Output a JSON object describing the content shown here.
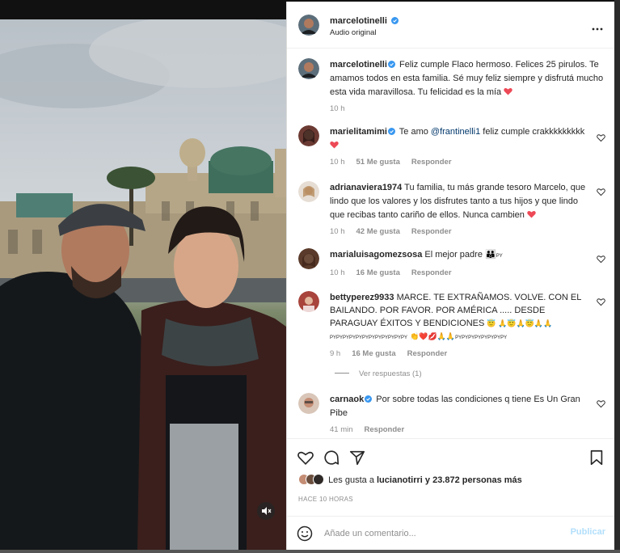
{
  "post": {
    "author": "marcelotinelli",
    "audio": "Audio original",
    "caption_user": "marcelotinelli",
    "caption_text": "Feliz cumple Flaco hermoso. Felices 25 pirulos. Te amamos todos en esta familia. Sé muy feliz siempre y disfrutá mucho esta vida maravillosa. Tu felicidad es la mía",
    "caption_time": "10 h"
  },
  "comments": [
    {
      "user": "marielitamimi",
      "pre": "Te amo ",
      "mention": "@frantinelli1",
      "text": " feliz cumple crakkkkkkkkk",
      "time": "10 h",
      "likes": "51 Me gusta",
      "reply": "Responder"
    },
    {
      "user": "adrianaviera1974",
      "text": "Tu familia, tu más grande tesoro Marcelo, que lindo que los valores y los disfrutes tanto a tus hijos y que lindo que recibas tanto cariño de ellos. Nunca cambien",
      "time": "10 h",
      "likes": "42 Me gusta",
      "reply": "Responder"
    },
    {
      "user": "marialuisagomezsosa",
      "text": "El mejor padre",
      "suffix": "PY",
      "time": "10 h",
      "likes": "16 Me gusta",
      "reply": "Responder"
    },
    {
      "user": "bettyperez9933",
      "text": "MARCE. TE EXTRAÑAMOS. VOLVE. CON EL BAILANDO. POR FAVOR. POR AMÉRICA ..... DESDE PARAGUAY ÉXITOS Y BENDICIONES",
      "py1": "PYPYPYPYPYPYPYPY",
      "py2": "PYPYPYPY",
      "py3": "PYPYPYPYPYPYPYPY",
      "time": "9 h",
      "likes": "16 Me gusta",
      "reply": "Responder",
      "view_replies": "Ver respuestas (1)"
    },
    {
      "user": "carnaok",
      "text": "Por sobre todas las condiciones q tiene Es Un Gran Pibe",
      "time": "41 min",
      "reply": "Responder"
    }
  ],
  "likes_line": {
    "prefix": "Les gusta a ",
    "user": "lucianotirri",
    "suffix": " y 23.872 personas más"
  },
  "time_ago": "HACE 10 HORAS",
  "add_comment": {
    "placeholder": "Añade un comentario...",
    "post_label": "Publicar"
  },
  "colors": {
    "heart_red": "#ed4956",
    "verified_blue": "#3897f0",
    "post_disabled": "#b2dffc"
  },
  "icons": [
    "more-options-icon",
    "heart-icon",
    "comment-icon",
    "share-icon",
    "bookmark-icon",
    "emoji-icon",
    "mute-icon"
  ]
}
